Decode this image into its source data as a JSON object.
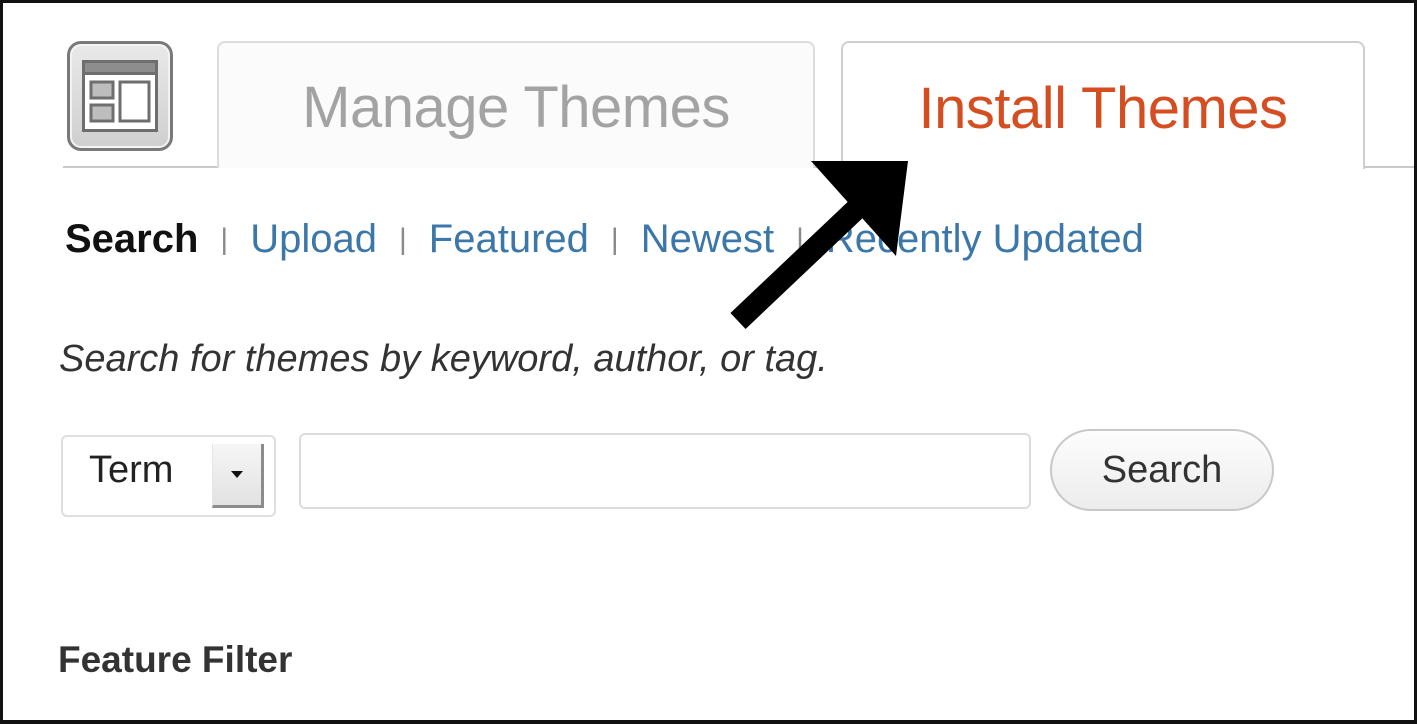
{
  "tabs": {
    "manage_label": "Manage Themes",
    "install_label": "Install Themes",
    "active_tab": "Install Themes",
    "active_color": "#d54e21",
    "inactive_color": "#a3a3a3"
  },
  "subnav": {
    "items": [
      "Search",
      "Upload",
      "Featured",
      "Newest",
      "Recently Updated"
    ],
    "current": "Search",
    "separator": "|",
    "link_color": "#3b77a8"
  },
  "search_form": {
    "description": "Search for themes by keyword, author, or tag.",
    "type_select_value": "Term",
    "input_value": "",
    "button_label": "Search"
  },
  "feature_filter": {
    "heading": "Feature Filter"
  },
  "icons": {
    "header_icon": "themes-layout-icon",
    "dropdown_icon": "caret-down-icon",
    "annotation": "arrow-annotation-icon"
  }
}
